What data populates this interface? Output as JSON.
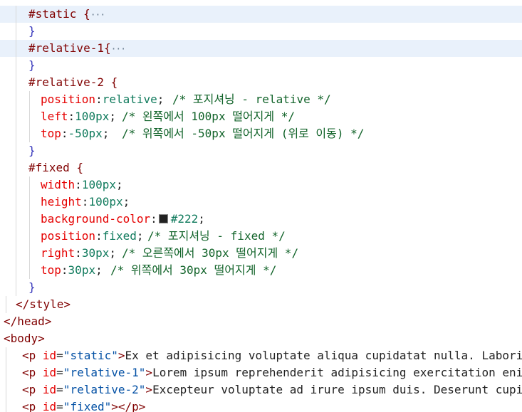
{
  "editor": {
    "lines": [
      {
        "t": "#static {",
        "fold": "···"
      },
      {
        "t": "}"
      },
      {
        "t": "#relative-1{",
        "fold": "···"
      },
      {
        "t": "}"
      },
      {
        "t": "#relative-2 {"
      },
      {
        "p": "position",
        "v": "relative",
        "c": "/* 포지셔닝 - relative */"
      },
      {
        "p": "left",
        "v": "100px",
        "c": "/* 왼쪽에서 100px 떨어지게 */"
      },
      {
        "p": "top",
        "v": "-50px",
        "c": "/* 위쪽에서 -50px 떨어지게 (위로 이동) */"
      },
      {
        "t": "}"
      },
      {
        "t": "#fixed {"
      },
      {
        "p": "width",
        "v": "100px"
      },
      {
        "p": "height",
        "v": "100px"
      },
      {
        "p": "background-color",
        "v": "#222",
        "swatch": "#222222"
      },
      {
        "p": "position",
        "v": "fixed",
        "c": "/* 포지셔닝 - fixed */"
      },
      {
        "p": "right",
        "v": "30px",
        "c": "/* 오른쪽에서 30px 떨어지게 */"
      },
      {
        "p": "top",
        "v": "30px",
        "c": "/* 위쪽에서 30px 떨어지게 */"
      },
      {
        "t": "}"
      },
      {
        "t": "</style>"
      },
      {
        "t": "</head>"
      },
      {
        "t": "<body>"
      },
      {
        "id": "static",
        "text": "Ex et adipisicing voluptate aliqua cupidatat nulla. Laboris est sint"
      },
      {
        "id": "relative-1",
        "text": "Lorem ipsum reprehenderit adipisicing exercitation enim velit"
      },
      {
        "id": "relative-2",
        "text": "Excepteur voluptate ad irure ipsum duis. Deserunt cupidatat co"
      },
      {
        "id": "fixed",
        "text": "</p>"
      }
    ],
    "punct": {
      "colon": ":",
      "semi": ";",
      "p_open": "<p ",
      "id_attr": "id",
      "eq": "=",
      "gt": ">",
      "close_p": "</p>"
    },
    "colors": {
      "highlight": "#e9f1fb",
      "selector": "#800000",
      "property": "#e50000",
      "value": "#0f7a5c",
      "comment": "#116329",
      "string": "#0451a5"
    }
  }
}
